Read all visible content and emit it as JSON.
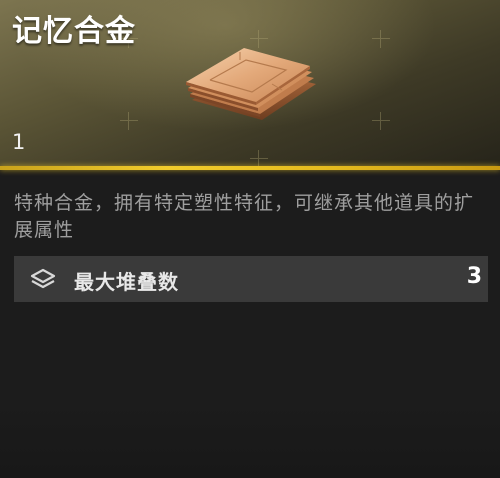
{
  "item": {
    "name": "记忆合金",
    "quantity": "1",
    "icon": "metal-plates-icon",
    "description": "特种合金，拥有特定塑性特征，可继承其他道具的扩展属性"
  },
  "stats": [
    {
      "icon": "stack-layers-icon",
      "label": "最大堆叠数",
      "value": "3"
    }
  ],
  "colors": {
    "accent": "#f2cd2c",
    "header_bg": "#5b5536",
    "panel_bg": "#1c1c1c",
    "stat_row_bg": "#3a3a3a",
    "description_text": "#9e9e9e"
  }
}
